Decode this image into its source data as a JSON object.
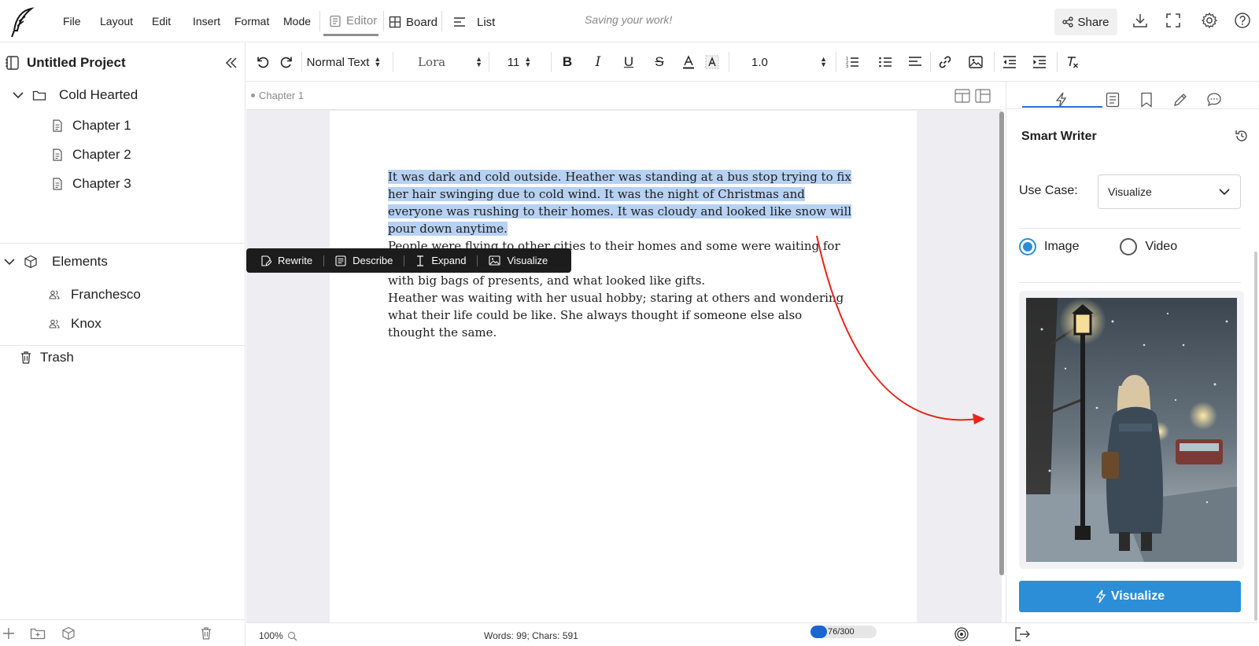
{
  "menu": {
    "file": "File",
    "layout": "Layout",
    "edit": "Edit",
    "insert": "Insert",
    "format": "Format",
    "mode": "Mode"
  },
  "views": {
    "editor": "Editor",
    "board": "Board",
    "list": "List"
  },
  "status_saving": "Saving your work!",
  "share_label": "Share",
  "sidebar": {
    "project_title": "Untitled Project",
    "folder": "Cold Hearted",
    "chapters": [
      "Chapter 1",
      "Chapter 2",
      "Chapter 3"
    ],
    "elements_label": "Elements",
    "elements": [
      "Franchesco",
      "Knox"
    ],
    "trash_label": "Trash"
  },
  "toolbar": {
    "style_value": "Normal Text",
    "font_value": "Lora",
    "size_value": "11",
    "line_spacing": "1.0"
  },
  "editor": {
    "breadcrumb": "Chapter 1",
    "selected_text": "It was dark and cold outside. Heather was standing at a bus stop trying to fix her hair swinging due to cold wind. It was the night of Christmas and everyone was rushing to their homes. It was cloudy and looked like snow will pour down anytime.",
    "line2": "People were flying to other cities to their homes and some were waiting for bus",
    "line3": "with big bags of presents, and what looked like gifts.",
    "line4": "Heather was waiting with her usual hobby; staring at others and wondering what their life could be like. She always thought if someone else also thought the same."
  },
  "ai_toolbar": {
    "rewrite": "Rewrite",
    "describe": "Describe",
    "expand": "Expand",
    "visualize": "Visualize"
  },
  "smart_writer": {
    "title": "Smart Writer",
    "use_case_label": "Use Case:",
    "use_case_value": "Visualize",
    "option_image": "Image",
    "option_video": "Video",
    "selected_option": "Image",
    "button_label": "Visualize"
  },
  "statusbar": {
    "zoom": "100%",
    "counts": "Words: 99; Chars: 591",
    "credits_text": "76/300",
    "credits_fraction": 0.2533
  },
  "colors": {
    "accent": "#2b8ed6",
    "selection": "#b6d1f2",
    "arrow": "#e8231a",
    "credit_fill": "#1a66d1"
  }
}
